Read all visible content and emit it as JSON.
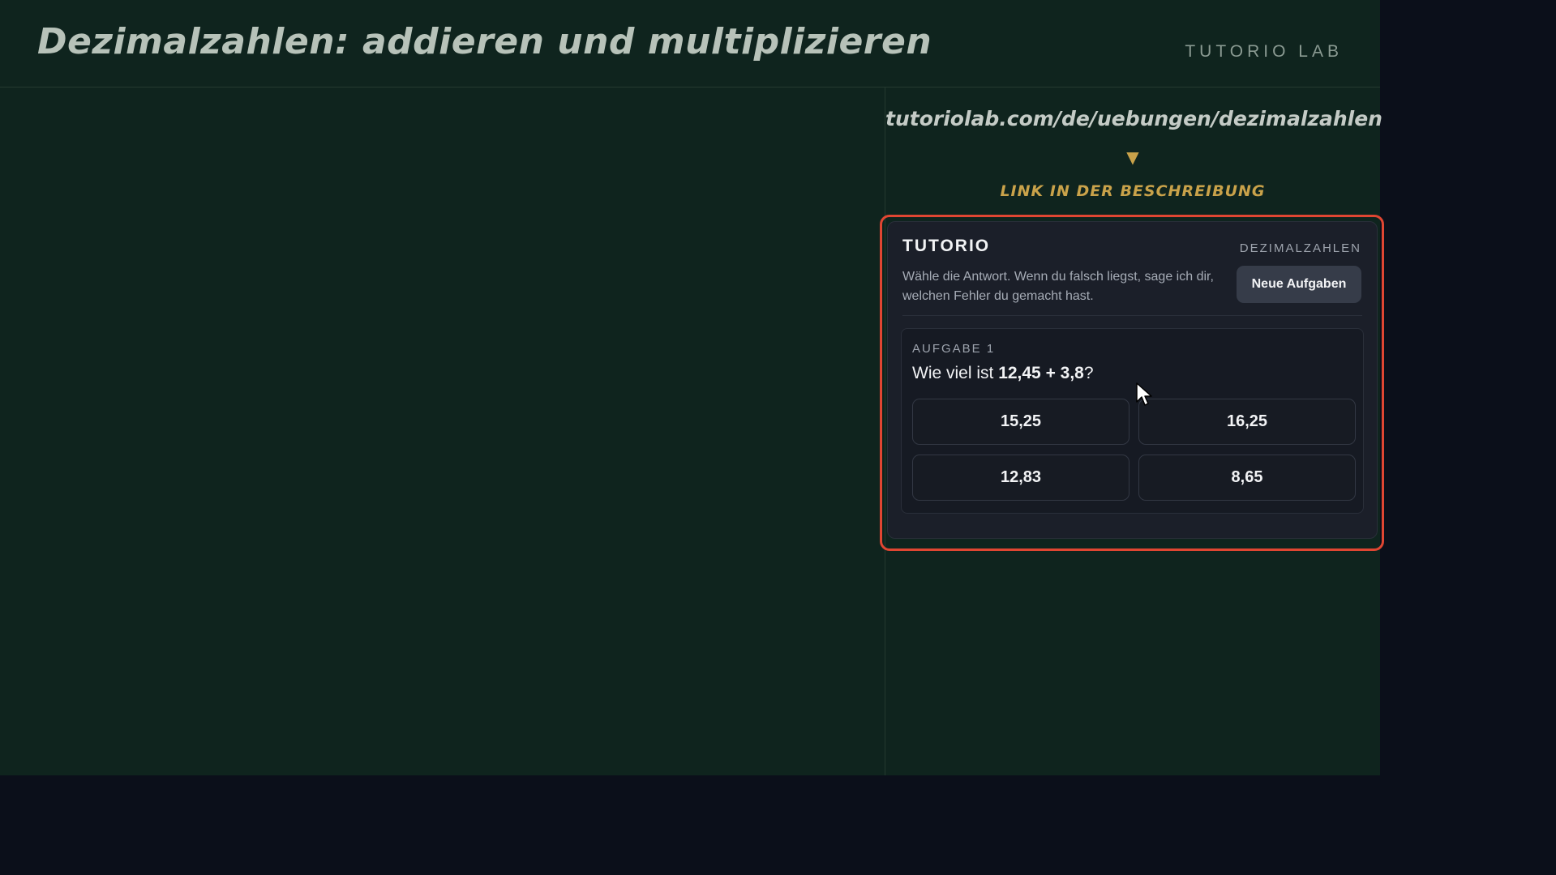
{
  "header": {
    "title": "Dezimalzahlen: addieren und multiplizieren",
    "brand": "TUTORIO LAB"
  },
  "sidebar": {
    "url": "tutoriolab.com/de/uebungen/dezimalzahlen",
    "arrow": "▼",
    "link_hint": "LINK IN DER BESCHREIBUNG"
  },
  "widget": {
    "brand": "TUTORIO",
    "topic": "DEZIMALZAHLEN",
    "description": "Wähle die Antwort. Wenn du falsch liegst, sage ich dir, welchen Fehler du gemacht hast.",
    "new_tasks_label": "Neue Aufgaben",
    "task": {
      "label": "AUFGABE 1",
      "question_prefix": "Wie viel ist ",
      "question_expression": "12,45 + 3,8",
      "question_suffix": "?",
      "answers": [
        "15,25",
        "16,25",
        "12,83",
        "8,65"
      ]
    }
  },
  "colors": {
    "board": "#0f241e",
    "page_background": "#0b0f1a",
    "accent": "#c9a24a",
    "highlight": "#e04632",
    "widget_background": "#1b1f29"
  },
  "icons": {
    "cursor": "mouse-pointer-icon",
    "arrow": "triangle-down-icon"
  }
}
